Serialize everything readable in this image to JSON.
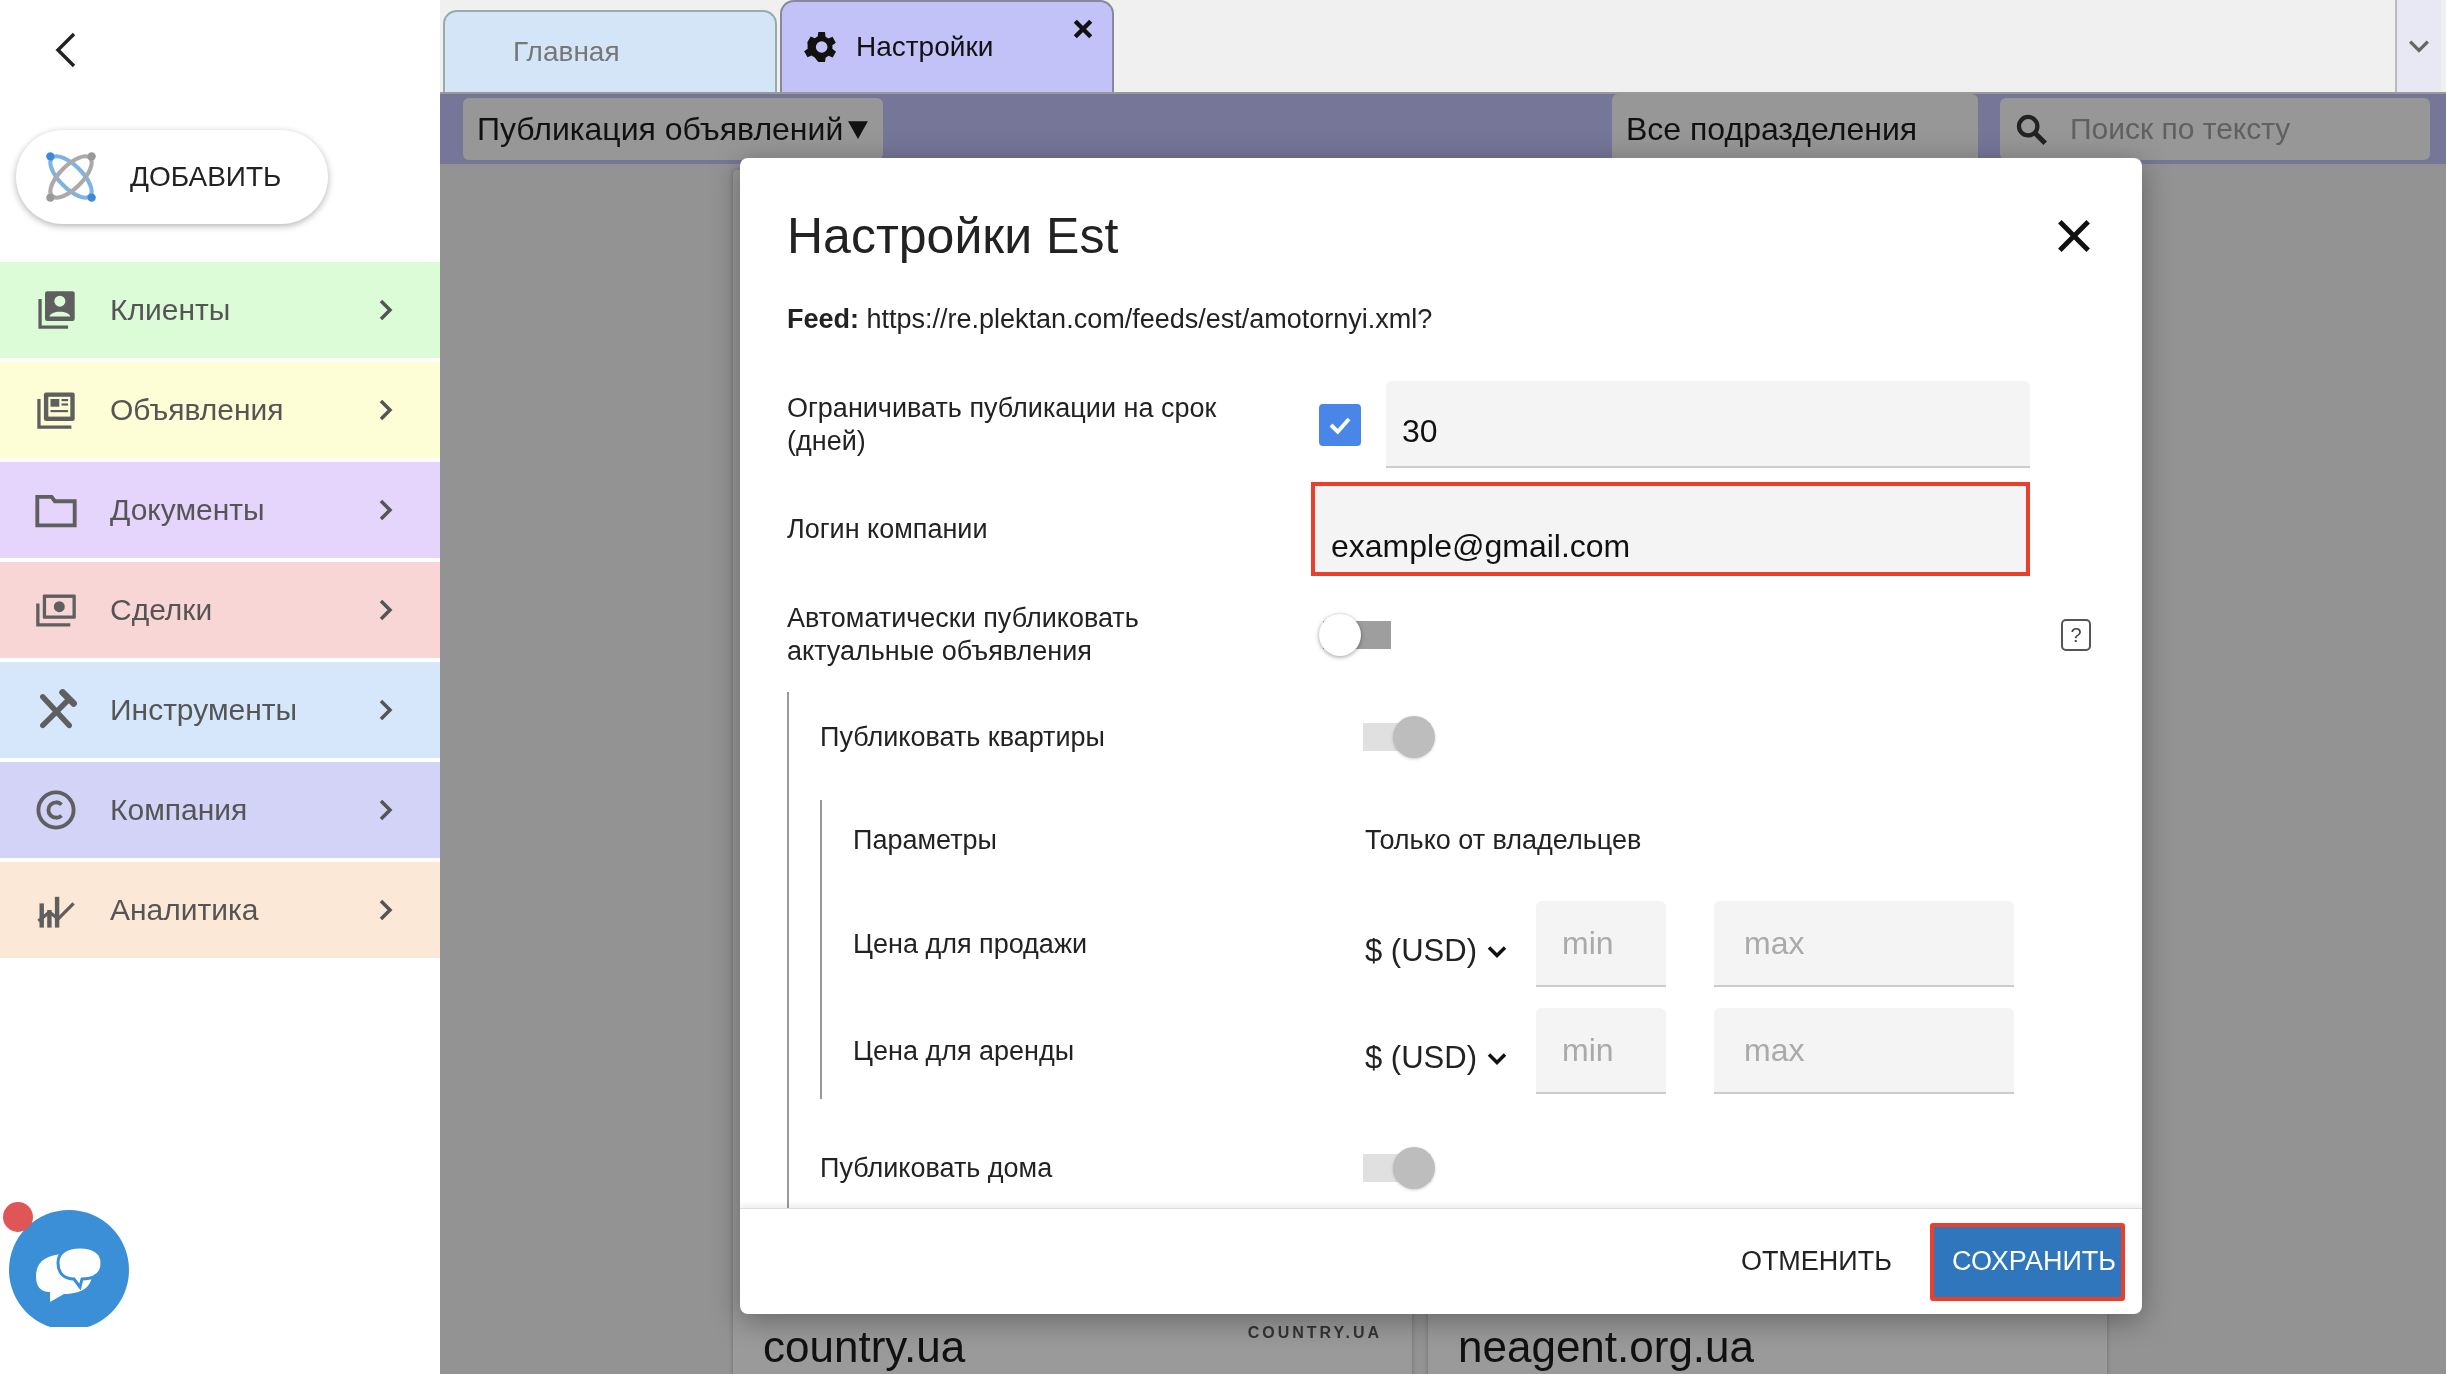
{
  "sidebar": {
    "add_button": "ДОБАВИТЬ",
    "items": [
      {
        "label": "Клиенты",
        "color": "#dcfcd8"
      },
      {
        "label": "Объявления",
        "color": "#fdfdd6"
      },
      {
        "label": "Документы",
        "color": "#e5d5fc"
      },
      {
        "label": "Сделки",
        "color": "#f9d6d6"
      },
      {
        "label": "Инструменты",
        "color": "#d6e7fb"
      },
      {
        "label": "Компания",
        "color": "#d3d3f8"
      },
      {
        "label": "Аналитика",
        "color": "#fbe8d7"
      }
    ],
    "chat": {
      "has_notification": true
    }
  },
  "tabs": [
    {
      "label": "Главная",
      "selected": false
    },
    {
      "label": "Настройки",
      "selected": true
    }
  ],
  "toolbar": {
    "section_select": "Публикация объявлений",
    "department_select": "Все подразделения",
    "search": {
      "placeholder": "Поиск по тексту"
    }
  },
  "cards": [
    {
      "title": "country.ua",
      "logo": "COUNTRY.UA"
    },
    {
      "title": "neagent.org.ua"
    }
  ],
  "dialog": {
    "title": "Настройки Est",
    "feed": "**Feed:** https://re.plektan.com/feeds/est/amotornyi.xml?",
    "limit": {
      "label": "Ограничивать публикации на срок (дней)",
      "checked": true,
      "value": "30"
    },
    "login": {
      "label": "Логин компании",
      "value": "example@gmail.com",
      "highlighted": true
    },
    "auto_publish": {
      "label": "Автоматически публиковать актуальные объявления",
      "on": false,
      "disabled": false,
      "help": "?"
    },
    "sections": [
      {
        "label": "Публиковать квартиры",
        "on": true,
        "disabled": true,
        "params": {
          "label": "Параметры",
          "value": "Только от владельцев"
        },
        "prices": [
          {
            "label": "Цена для продажи",
            "currency": "$ (USD)",
            "min_placeholder": "min",
            "max_placeholder": "max"
          },
          {
            "label": "Цена для аренды",
            "currency": "$ (USD)",
            "min_placeholder": "min",
            "max_placeholder": "max"
          }
        ]
      },
      {
        "label": "Публиковать дома",
        "on": true,
        "disabled": true
      }
    ],
    "cancel_button": "ОТМЕНИТЬ",
    "save_button": {
      "label": "СОХРАНИТЬ",
      "highlighted": true
    }
  }
}
